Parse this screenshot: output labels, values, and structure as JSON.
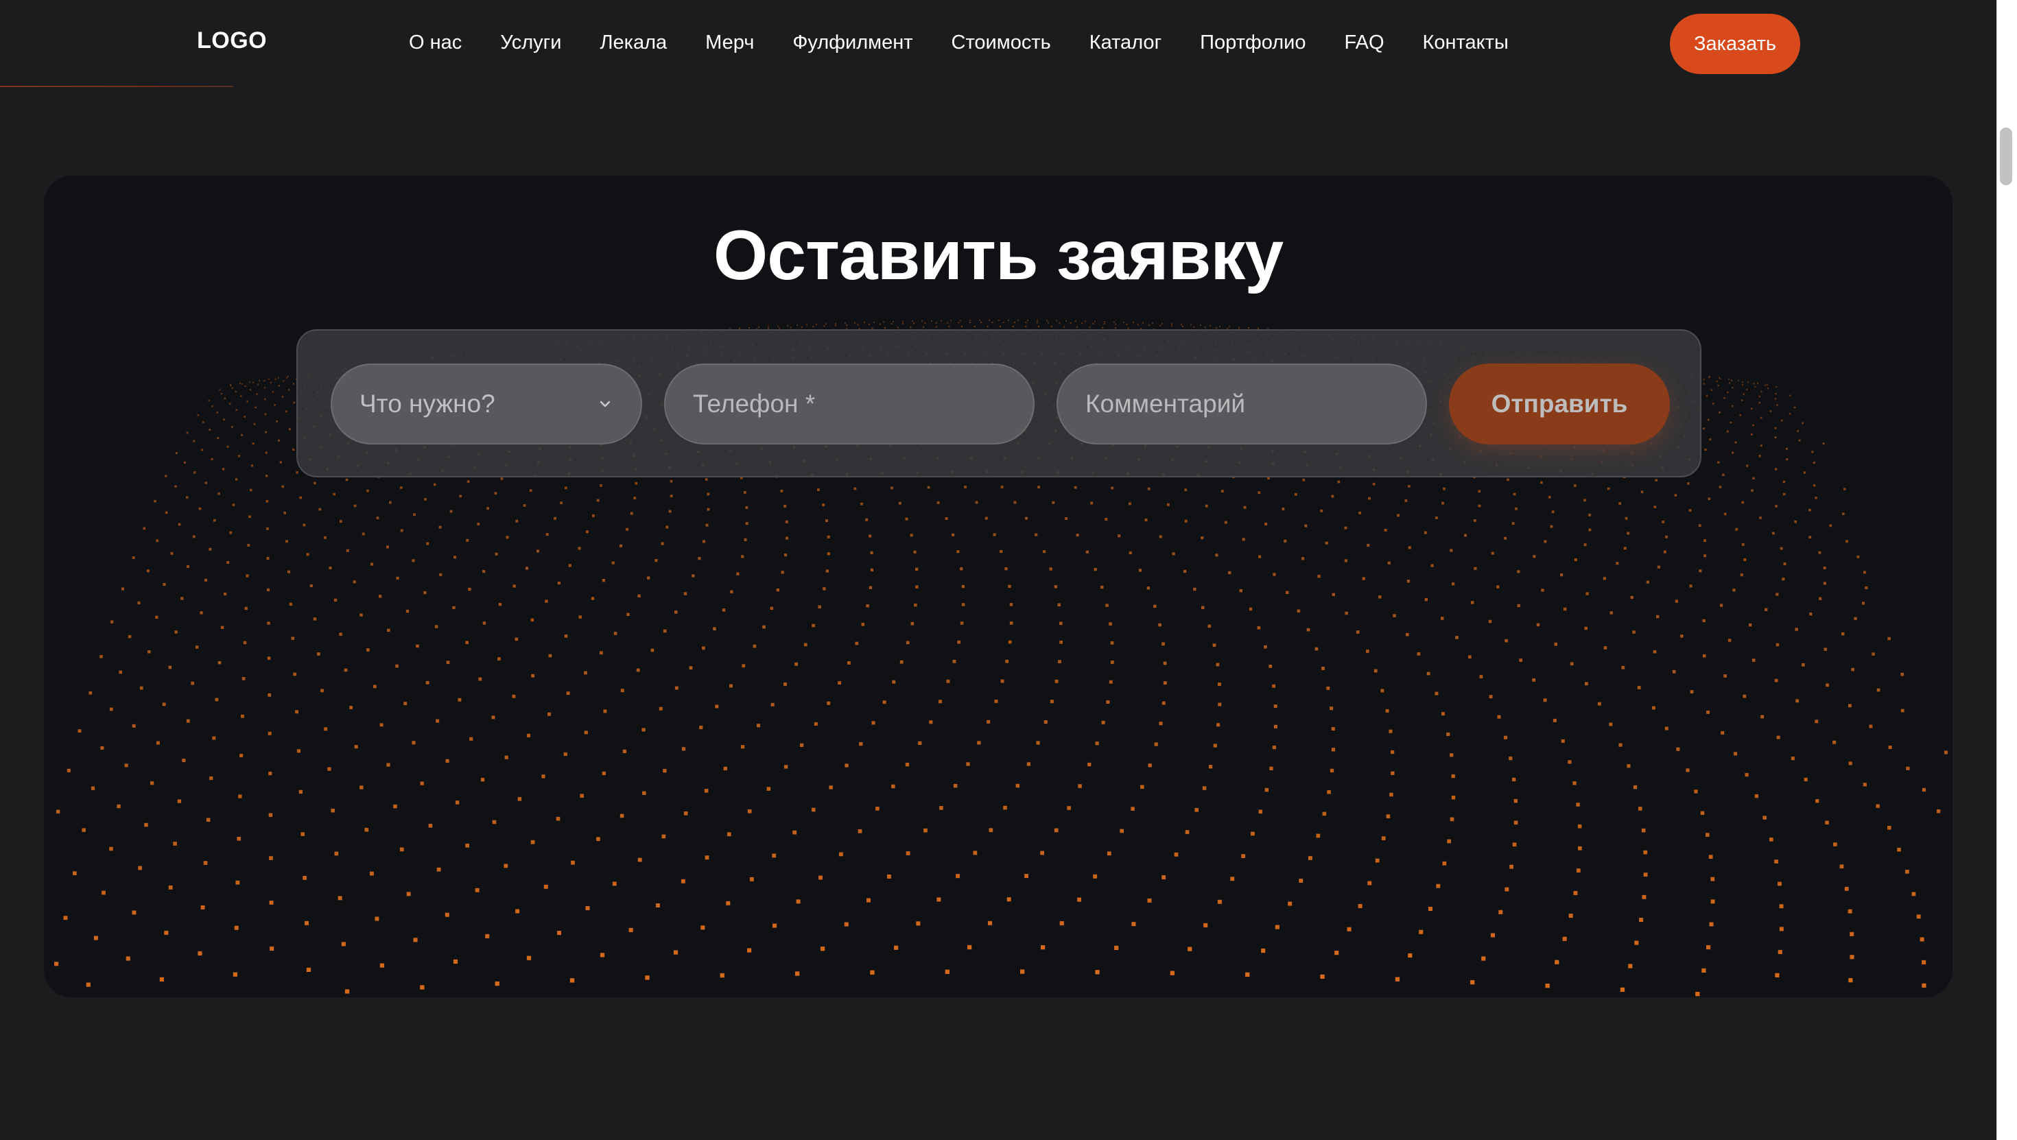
{
  "header": {
    "logo": "LOGO",
    "nav": [
      "О нас",
      "Услуги",
      "Лекала",
      "Мерч",
      "Фулфилмент",
      "Стоимость",
      "Каталог",
      "Портфолио",
      "FAQ",
      "Контакты"
    ],
    "order_button": "Заказать"
  },
  "form": {
    "title": "Оставить заявку",
    "need_placeholder": "Что нужно?",
    "phone_placeholder": "Телефон *",
    "comment_placeholder": "Комментарий",
    "submit_label": "Отправить"
  },
  "colors": {
    "background": "#1b1c1e",
    "card": "#101114",
    "accent": "#d8491c",
    "dots": "#e8721c"
  },
  "icons": {
    "select_chevron": "chevron-down-icon"
  }
}
